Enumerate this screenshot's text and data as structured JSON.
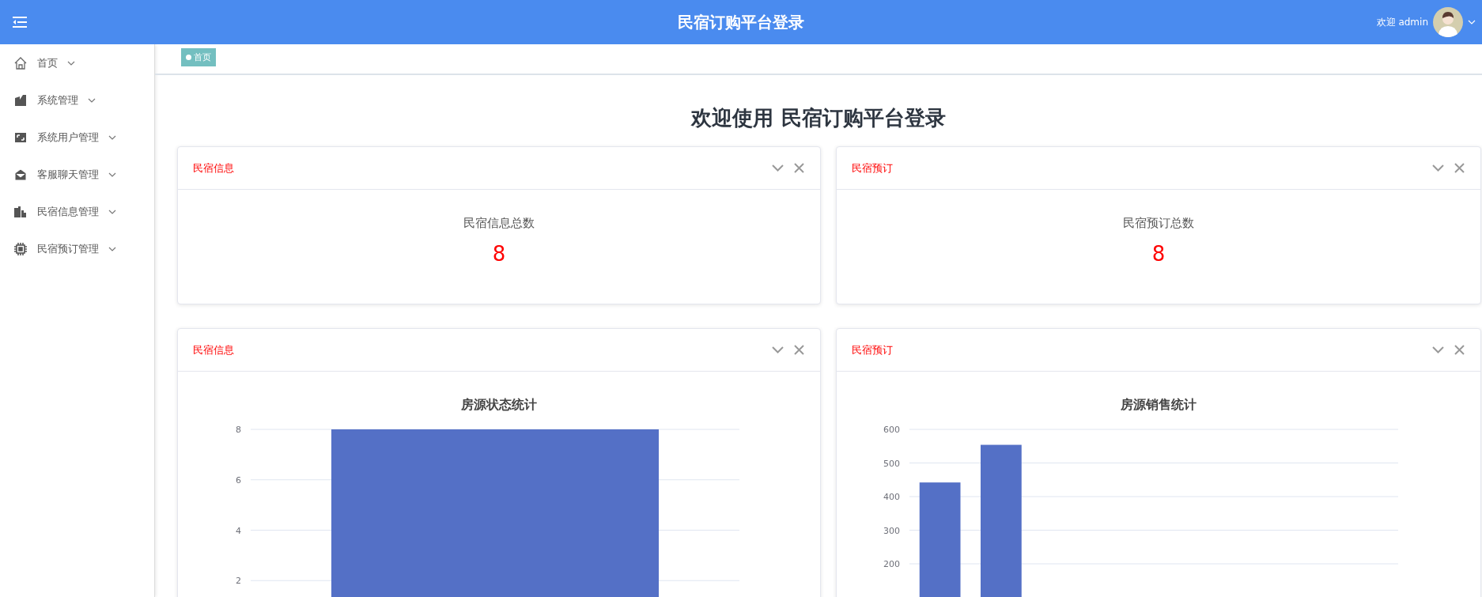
{
  "header": {
    "title": "民宿订购平台登录",
    "greeting": "欢迎 admin"
  },
  "sidebar": {
    "items": [
      {
        "label": "首页"
      },
      {
        "label": "系统管理"
      },
      {
        "label": "系统用户管理"
      },
      {
        "label": "客服聊天管理"
      },
      {
        "label": "民宿信息管理"
      },
      {
        "label": "民宿预订管理"
      }
    ]
  },
  "breadcrumb": [
    {
      "label": "首页",
      "selected": true
    }
  ],
  "welcome": "欢迎使用 民宿订购平台登录",
  "stat_cards": [
    {
      "title": "民宿信息",
      "label": "民宿信息总数",
      "value": "8"
    },
    {
      "title": "民宿预订",
      "label": "民宿预订总数",
      "value": "8"
    }
  ],
  "chart_cards": [
    {
      "title": "民宿信息",
      "chart_data": {
        "type": "bar",
        "title": "房源状态统计",
        "series": [
          {
            "color": "#5470c6",
            "values": [
              8
            ]
          }
        ],
        "ylim": [
          0,
          8
        ],
        "yticks": [
          2,
          4,
          6,
          8
        ],
        "grid": true
      }
    },
    {
      "title": "民宿预订",
      "chart_data": {
        "type": "bar",
        "title": "房源销售统计",
        "series": [
          {
            "color": "#5470c6",
            "values": [
              442,
              554,
              null,
              null,
              null,
              null,
              null,
              null
            ]
          }
        ],
        "ylim": [
          0,
          600
        ],
        "yticks": [
          200,
          300,
          400,
          500,
          600
        ],
        "grid": true
      }
    }
  ]
}
